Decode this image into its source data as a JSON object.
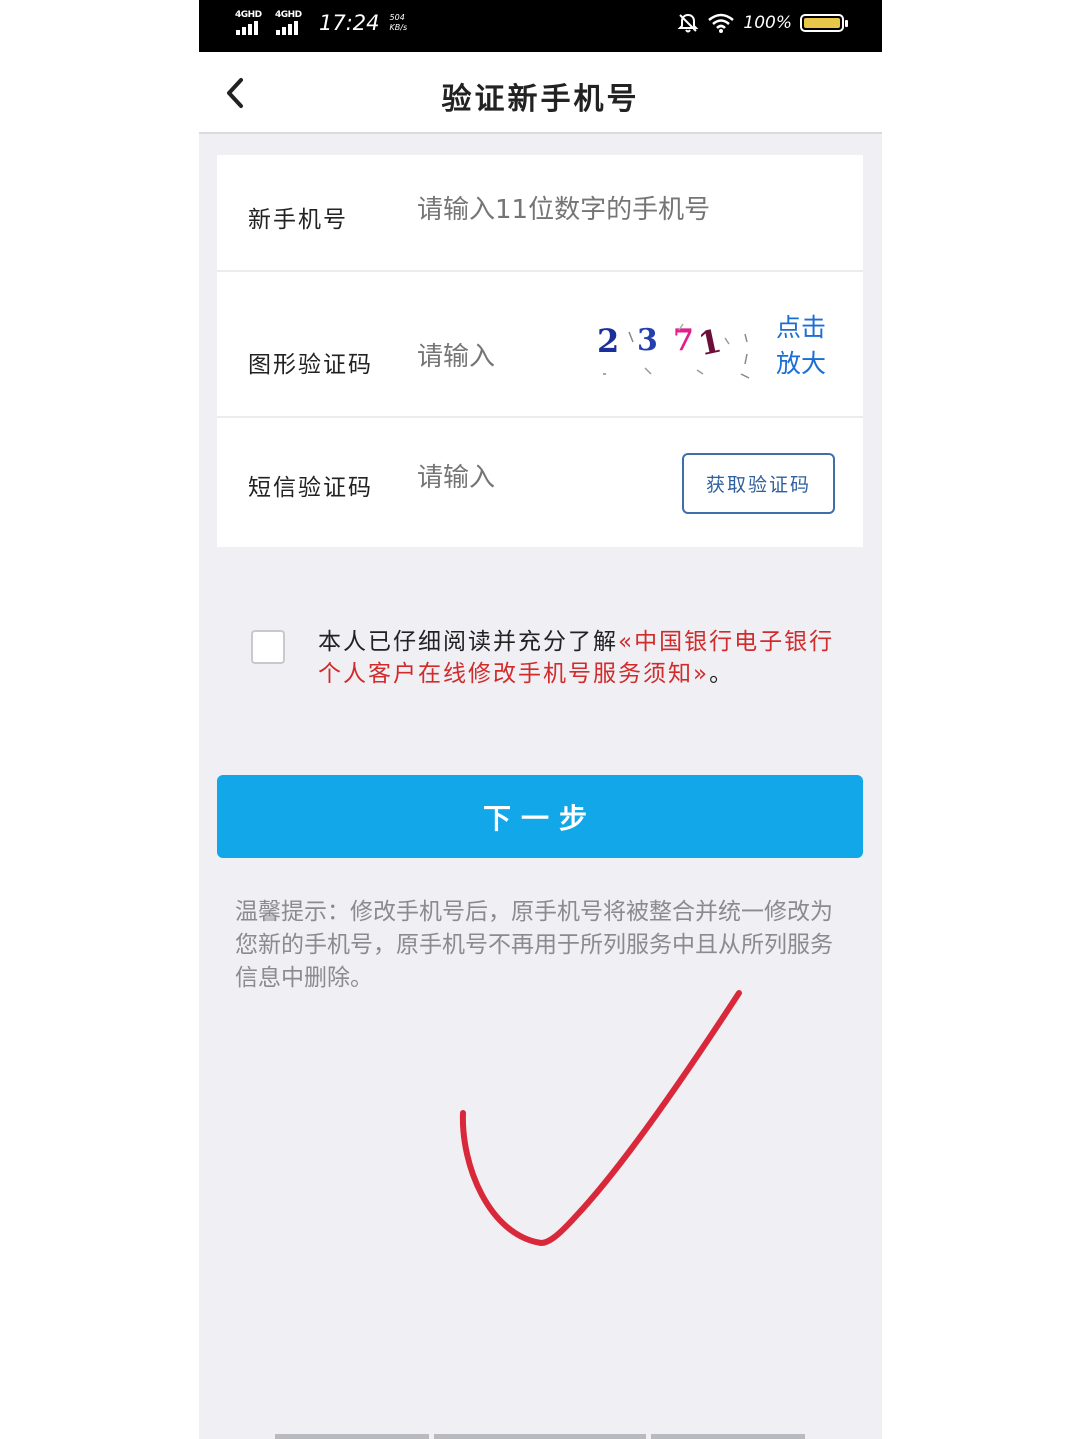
{
  "status_bar": {
    "signal1": "4GHD",
    "signal2": "4GHD",
    "time": "17:24",
    "speed_value": "504",
    "speed_unit": "KB/s",
    "battery": "100%"
  },
  "header": {
    "back_icon": "chevron-left-icon",
    "title": "验证新手机号"
  },
  "form": {
    "phone": {
      "label": "新手机号",
      "placeholder": "请输入11位数字的手机号"
    },
    "captcha": {
      "label": "图形验证码",
      "placeholder": "请输入",
      "image_text": "2371",
      "zoom_link": "点击放大",
      "zoom_line1": "点击",
      "zoom_line2": "放大"
    },
    "sms": {
      "label": "短信验证码",
      "placeholder": "请输入",
      "button": "获取验证码"
    }
  },
  "agreement": {
    "checked": false,
    "prefix": "本人已仔细阅读并充分了解",
    "link": "«中国银行电子银行个人客户在线修改手机号服务须知»",
    "suffix": "。"
  },
  "next_button": "下一步",
  "tip": "温馨提示：修改手机号后，原手机号将被整合并统一修改为您新的手机号，原手机号不再用于所列服务中且从所列服务信息中删除。",
  "colors": {
    "primary": "#12a7e8",
    "link_blue": "#1b6ed6",
    "agreement_red": "#d12b2b",
    "background": "#efeff4",
    "annotation_red": "#d8283a"
  }
}
